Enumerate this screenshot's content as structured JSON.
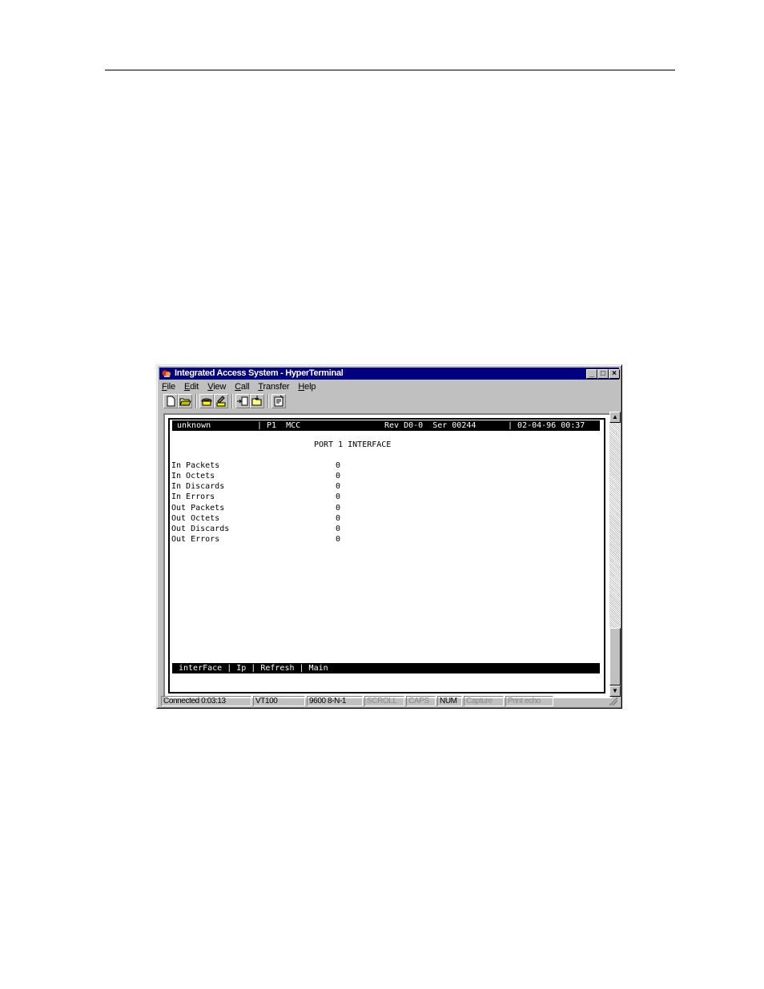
{
  "window": {
    "title": "Integrated Access System - HyperTerminal",
    "controls": {
      "minimize": "_",
      "maximize": "□",
      "close": "×"
    }
  },
  "menu": [
    {
      "hotkey": "F",
      "rest": "ile"
    },
    {
      "hotkey": "E",
      "rest": "dit"
    },
    {
      "hotkey": "V",
      "rest": "iew"
    },
    {
      "hotkey": "C",
      "rest": "all"
    },
    {
      "hotkey": "T",
      "rest": "ransfer"
    },
    {
      "hotkey": "H",
      "rest": "elp"
    }
  ],
  "toolbar": {
    "icons": [
      "new-document-icon",
      "open-folder-icon",
      "connect-phone-icon",
      "disconnect-phone-icon",
      "send-file-icon",
      "receive-file-icon",
      "properties-icon"
    ]
  },
  "terminal": {
    "header": {
      "system_name": "unknown",
      "port_info": "| P1  MCC",
      "revision": "Rev D0-0  Ser 00244",
      "datetime": "| 02-04-96 00:37"
    },
    "screen_title": "PORT 1 INTERFACE",
    "stats": [
      {
        "label": "In Packets",
        "value": "0"
      },
      {
        "label": "In Octets",
        "value": "0"
      },
      {
        "label": "In Discards",
        "value": "0"
      },
      {
        "label": "In Errors",
        "value": "0"
      },
      {
        "label": "Out Packets",
        "value": "0"
      },
      {
        "label": "Out Octets",
        "value": "0"
      },
      {
        "label": "Out Discards",
        "value": "0"
      },
      {
        "label": "Out Errors",
        "value": "0"
      }
    ],
    "footer": "interFace | Ip | Refresh | Main"
  },
  "statusbar": {
    "connected": "Connected 0:03:13",
    "emulation": "VT100",
    "settings": "9600 8-N-1",
    "scroll": "SCROLL",
    "caps": "CAPS",
    "num": "NUM",
    "capture": "Capture",
    "print_echo": "Print echo"
  },
  "colors": {
    "titlebar": "#000080",
    "face": "#c0c0c0",
    "terminal_bg": "#ffffff",
    "terminal_bar": "#000000"
  }
}
